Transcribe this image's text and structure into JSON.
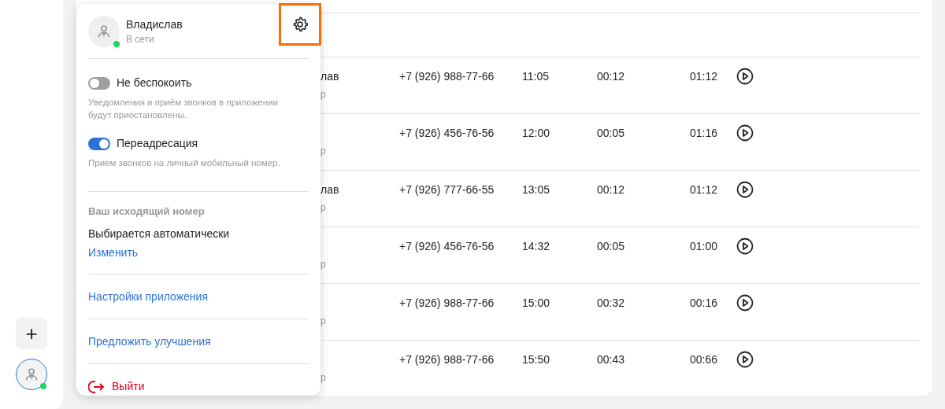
{
  "sidebar": {
    "add_button": "+",
    "user": {
      "online": true
    }
  },
  "table": {
    "rows": [
      {
        "name": "лав",
        "subtitle": "р",
        "phone": "+7 (926) 988-77-66",
        "time": "11:05",
        "column_4": "00:12",
        "column_5": "01:12"
      },
      {
        "subtitle": "р",
        "phone": "+7 (926) 456-76-56",
        "time": "12:00",
        "column_4": "00:05",
        "column_5": "01:16"
      },
      {
        "name": "лав",
        "subtitle": "р",
        "phone": "+7 (926) 777-66-55",
        "time": "13:05",
        "column_4": "00:12",
        "column_5": "01:12"
      },
      {
        "subtitle": "р",
        "phone": "+7 (926) 456-76-56",
        "time": "14:32",
        "column_4": "00:05",
        "column_5": "01:00"
      },
      {
        "subtitle": "р",
        "phone": "+7 (926) 988-77-66",
        "time": "15:00",
        "column_4": "00:32",
        "column_5": "00:16"
      },
      {
        "subtitle": "р",
        "phone": "+7 (926) 988-77-66",
        "time": "15:50",
        "column_4": "00:43",
        "column_5": "00:66"
      }
    ]
  },
  "popup": {
    "user": {
      "name": "Владислав",
      "status": "В сети",
      "online": true
    },
    "settings_highlighted": true,
    "toggles": [
      {
        "label": "Не беспокоить",
        "description": "Уведомления и приём звонков в приложении будут приостановлены.",
        "on": false
      },
      {
        "label": "Переадресация",
        "description": "Прием звонков на личный мобильный номер.",
        "on": true
      }
    ],
    "outgoing": {
      "heading": "Ваш исходящий номер",
      "value": "Выбирается автоматически",
      "link": "Изменить"
    },
    "links": [
      "Настройки приложения",
      "Предложить улучшения"
    ],
    "logout": "Выйти"
  }
}
